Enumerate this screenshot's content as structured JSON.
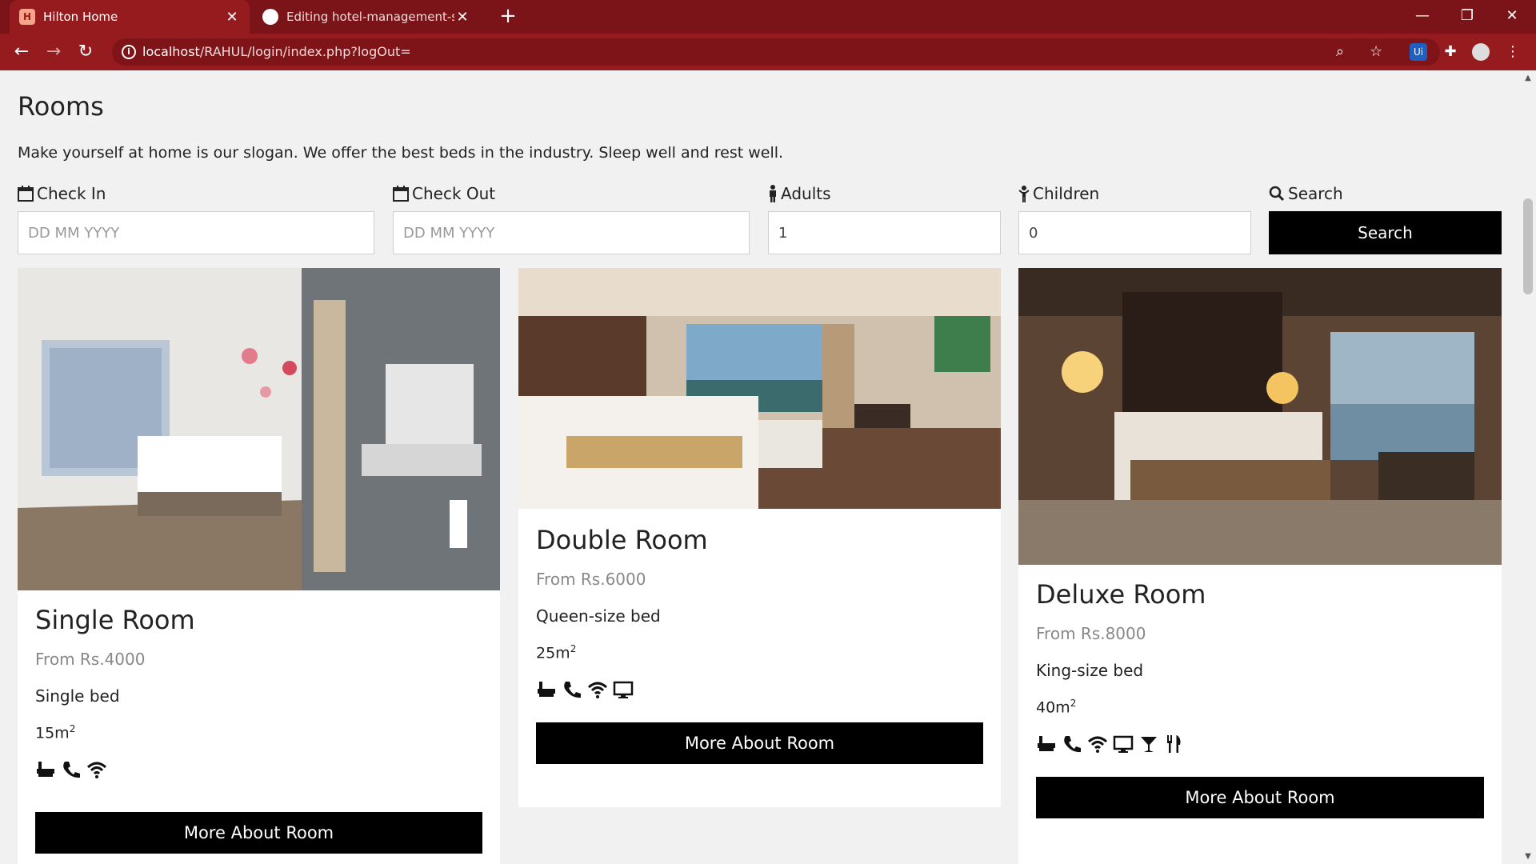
{
  "browser": {
    "tabs": [
      {
        "title": "Hilton Home",
        "active": true
      },
      {
        "title": "Editing hotel-management-syste",
        "active": false
      }
    ],
    "url_host": "localhost",
    "url_path": "/RAHUL/login/index.php?logOut=",
    "extension_label": "Ui"
  },
  "page": {
    "heading": "Rooms",
    "tagline": "Make yourself at home is our slogan. We offer the best beds in the industry. Sleep well and rest well.",
    "form": {
      "check_in_label": "Check In",
      "check_in_placeholder": "DD MM YYYY",
      "check_out_label": "Check Out",
      "check_out_placeholder": "DD MM YYYY",
      "adults_label": "Adults",
      "adults_value": "1",
      "children_label": "Children",
      "children_value": "0",
      "search_label": "Search",
      "search_button": "Search"
    },
    "rooms": [
      {
        "name": "Single Room",
        "price": "From Rs.4000",
        "bed": "Single bed",
        "size": "15m",
        "amenities": [
          "bath-icon",
          "phone-icon",
          "wifi-icon"
        ],
        "button": "More About Room"
      },
      {
        "name": "Double Room",
        "price": "From Rs.6000",
        "bed": "Queen-size bed",
        "size": "25m",
        "amenities": [
          "bath-icon",
          "phone-icon",
          "wifi-icon",
          "tv-icon"
        ],
        "button": "More About Room"
      },
      {
        "name": "Deluxe Room",
        "price": "From Rs.8000",
        "bed": "King-size bed",
        "size": "40m",
        "amenities": [
          "bath-icon",
          "phone-icon",
          "wifi-icon",
          "tv-icon",
          "cocktail-icon",
          "restaurant-icon"
        ],
        "button": "More About Room"
      }
    ],
    "size_unit_sup": "2"
  }
}
